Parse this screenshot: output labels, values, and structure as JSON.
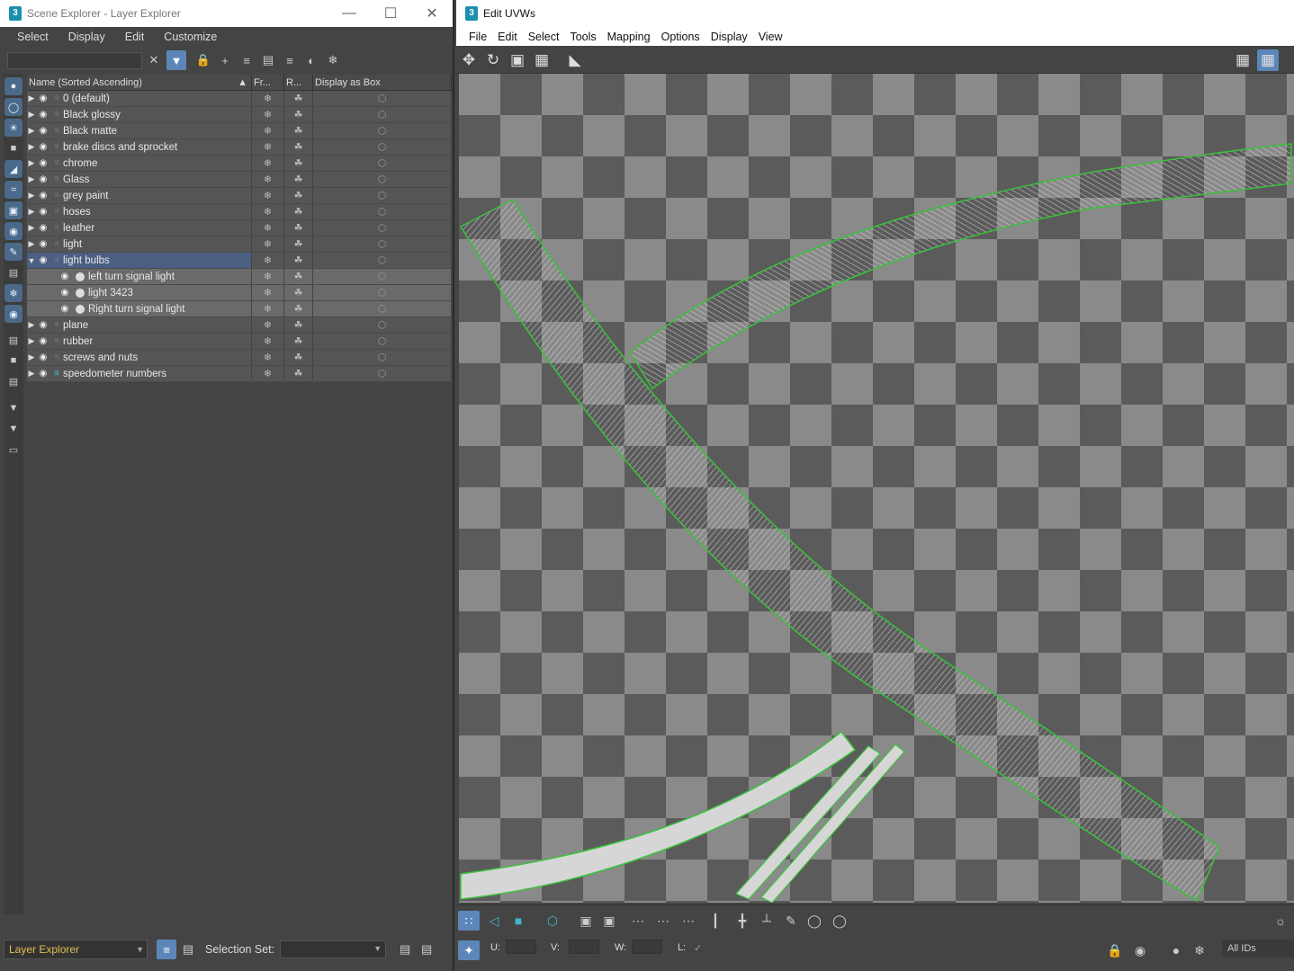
{
  "scene_explorer": {
    "title": "Scene Explorer - Layer Explorer",
    "menu": [
      "Select",
      "Display",
      "Edit",
      "Customize"
    ],
    "columns": {
      "name": "Name (Sorted Ascending)",
      "freeze": "Fr...",
      "render": "R...",
      "box": "Display as Box"
    },
    "rows": [
      {
        "name": "0 (default)"
      },
      {
        "name": "Black glossy"
      },
      {
        "name": "Black matte"
      },
      {
        "name": "brake discs and sprocket"
      },
      {
        "name": "chrome"
      },
      {
        "name": "Glass"
      },
      {
        "name": "grey paint"
      },
      {
        "name": "hoses"
      },
      {
        "name": "leather"
      },
      {
        "name": "light"
      },
      {
        "name": "light bulbs"
      },
      {
        "name": "left turn signal light"
      },
      {
        "name": "light 3423"
      },
      {
        "name": "Right turn signal light"
      },
      {
        "name": "plane"
      },
      {
        "name": "rubber"
      },
      {
        "name": "screws and nuts"
      },
      {
        "name": "speedometer numbers"
      }
    ],
    "explorer_dropdown": "Layer Explorer",
    "selection_set_label": "Selection Set:",
    "selection_set_value": ""
  },
  "uv_editor": {
    "title": "Edit UVWs",
    "menu": [
      "File",
      "Edit",
      "Select",
      "Tools",
      "Mapping",
      "Options",
      "Display",
      "View"
    ],
    "u_label": "U:",
    "v_label": "V:",
    "w_label": "W:",
    "l_label": "L:",
    "ids_label": "All IDs",
    "accent": "#3fb6d4",
    "uv_outline_color": "#39c23a"
  },
  "icons": {
    "freeze": "snowflake-icon",
    "render": "teapot-icon",
    "box": "cube-icon",
    "visibility": "eye-icon"
  }
}
